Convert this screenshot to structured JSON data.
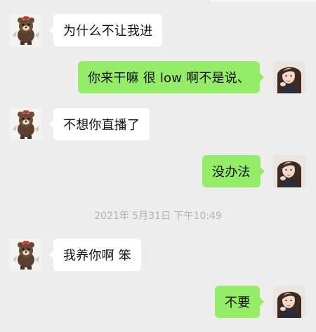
{
  "colors": {
    "background": "#ededed",
    "bubble_left": "#ffffff",
    "bubble_right": "#95ec69",
    "timestamp_text": "#b2b2b2"
  },
  "messages": [
    {
      "side": "left",
      "text": "为什么不让我进",
      "avatar": "bear-avatar"
    },
    {
      "side": "right",
      "text": "你来干嘛 很 low 啊不是说、",
      "avatar": "girl-avatar"
    },
    {
      "side": "left",
      "text": "不想你直播了",
      "avatar": "bear-avatar"
    },
    {
      "side": "right",
      "text": "没办法",
      "avatar": "girl-avatar"
    },
    {
      "side": "left",
      "text": "我养你啊 笨",
      "avatar": "bear-avatar"
    },
    {
      "side": "right",
      "text": "不要",
      "avatar": "girl-avatar"
    }
  ],
  "timestamp": "2021年 5月31日 下午10:49"
}
